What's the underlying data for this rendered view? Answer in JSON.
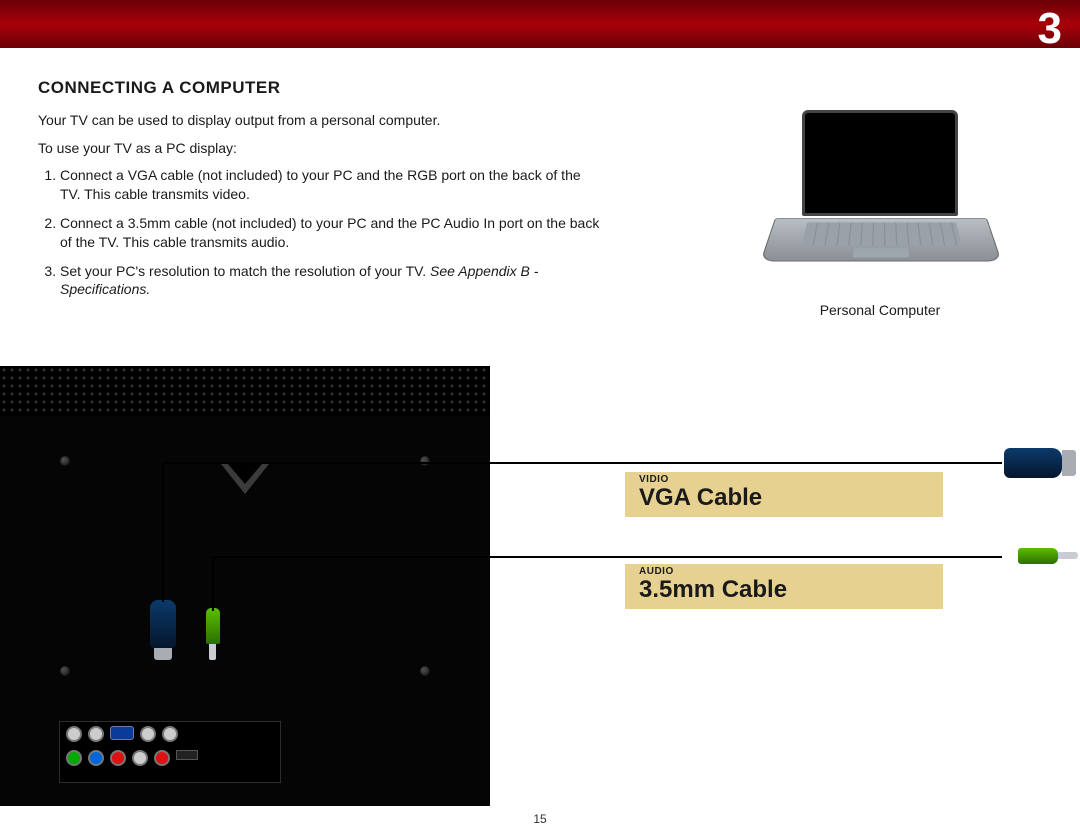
{
  "chapter_number": "3",
  "heading": "CONNECTING A COMPUTER",
  "intro": "Your TV can be used to display output from a personal computer.",
  "subintro": "To use your TV as a PC display:",
  "steps": [
    "Connect a VGA cable (not included) to your PC and the RGB port on the back of the TV. This cable transmits video.",
    "Connect a 3.5mm cable (not included) to your PC and the PC Audio In port on the back of the TV. This cable transmits audio.",
    "Set your PC's resolution to match the resolution of your TV."
  ],
  "step3_note": "See Appendix B - Specifications.",
  "laptop_caption": "Personal Computer",
  "label_vga_small": "VIDIO",
  "label_vga_big": "VGA Cable",
  "label_audio_small": "AUDIO",
  "label_audio_big": "3.5mm Cable",
  "page_number": "15",
  "colors": {
    "brand_red": "#a8000a",
    "label_bg": "#e6d191",
    "vga_blue": "#0c3a6a",
    "audio_green": "#5bbf00"
  }
}
